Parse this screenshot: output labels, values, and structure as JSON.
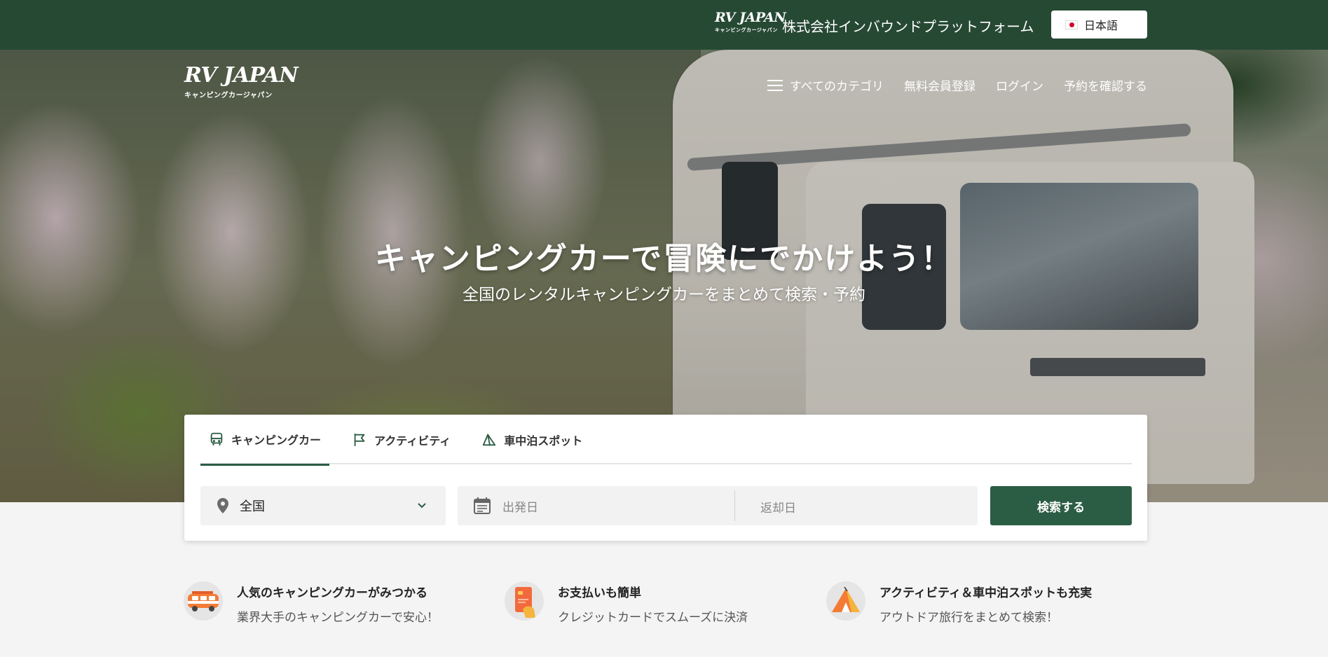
{
  "topbar": {
    "logo_main": "RV JAPAN",
    "logo_sub": "キャンピングカージャパン",
    "company": "株式会社インバウンドプラットフォーム",
    "language": "日本語"
  },
  "header": {
    "logo_main": "RV JAPAN",
    "logo_sub": "キャンピングカージャパン",
    "nav": {
      "categories": "すべてのカテゴリ",
      "register": "無料会員登録",
      "login": "ログイン",
      "reservation": "予約を確認する"
    }
  },
  "hero": {
    "title": "キャンピングカーで冒険にでかけよう！",
    "subtitle": "全国のレンタルキャンピングカーをまとめて検索・予約"
  },
  "search": {
    "tabs": [
      "キャンピングカー",
      "アクティビティ",
      "車中泊スポット"
    ],
    "active_tab": 0,
    "area_value": "全国",
    "departure_placeholder": "出発日",
    "return_placeholder": "返却日",
    "search_button": "検索する",
    "accent_color": "#2b5d44"
  },
  "features": [
    {
      "title": "人気のキャンピングカーがみつかる",
      "text": "業界大手のキャンピングカーで安心！",
      "icon": "camper-van-icon"
    },
    {
      "title": "お支払いも簡単",
      "text": "クレジットカードでスムーズに決済",
      "icon": "credit-card-icon"
    },
    {
      "title": "アクティビティ＆車中泊スポットも充実",
      "text": "アウトドア旅行をまとめて検索！",
      "icon": "tent-icon"
    }
  ],
  "colors": {
    "topbar": "#264934",
    "primary": "#2b5d44"
  }
}
